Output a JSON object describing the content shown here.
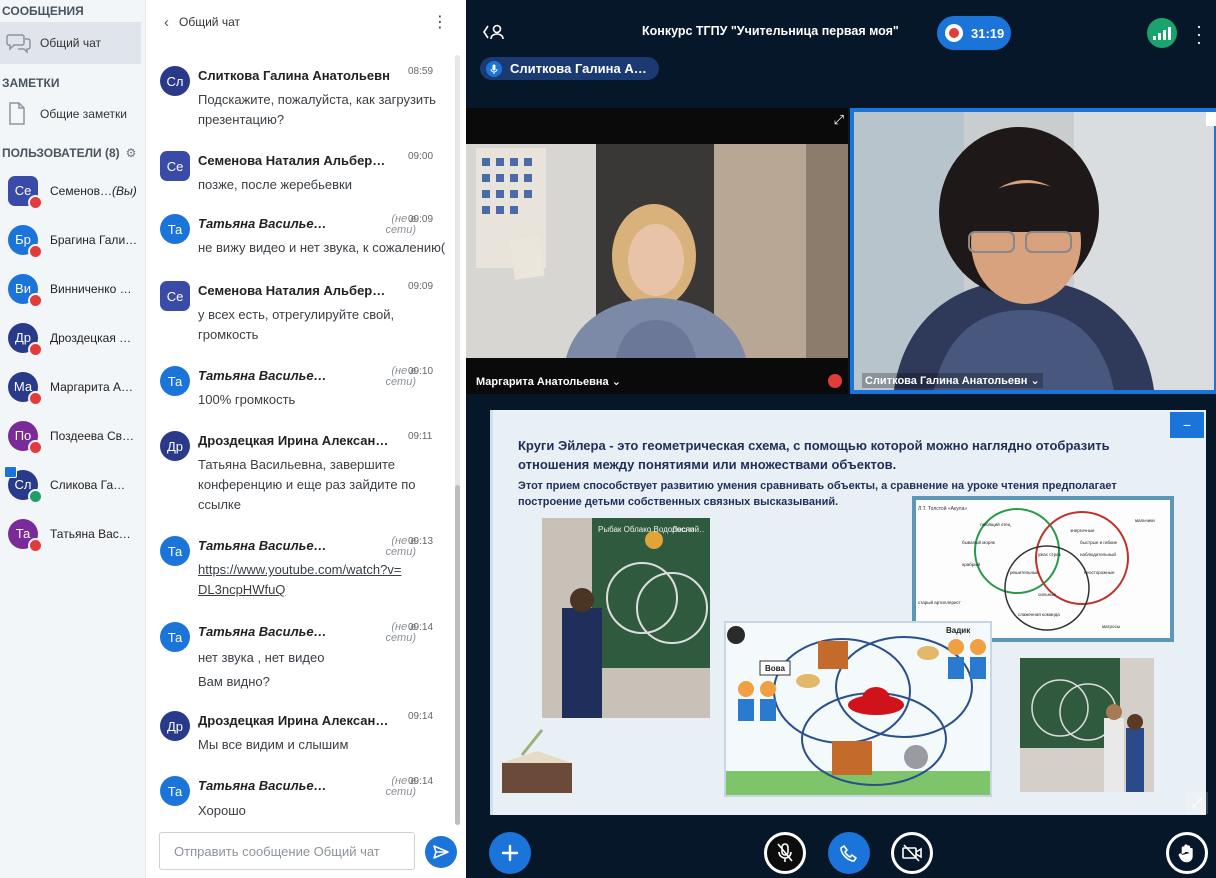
{
  "sidebar": {
    "messages_header": "СООБЩЕНИЯ",
    "public_chat": "Общий чат",
    "notes_header": "ЗАМЕТКИ",
    "shared_notes": "Общие заметки",
    "users_header": "ПОЛЬЗОВАТЕЛИ (8)",
    "users": [
      {
        "initials": "Се",
        "name": "Семенов…",
        "suffix": "(Вы)",
        "color": "#3a4aa8"
      },
      {
        "initials": "Бр",
        "name": "Брагина Гали…",
        "color": "#1b74d9"
      },
      {
        "initials": "Ви",
        "name": "Винниченко …",
        "color": "#1b74d9"
      },
      {
        "initials": "Др",
        "name": "Дроздецкая …",
        "color": "#2a3a8a"
      },
      {
        "initials": "Ма",
        "name": "Маргарита А…",
        "color": "#2a3a8a"
      },
      {
        "initials": "По",
        "name": "Поздеева Св…",
        "color": "#7b2a9a"
      },
      {
        "initials": "Сл",
        "name": "Сликова Га…",
        "color": "#2a3a8a"
      },
      {
        "initials": "Та",
        "name": "Татьяна Вас…",
        "color": "#7b2a9a"
      }
    ]
  },
  "chat": {
    "title": "Общий чат",
    "offline": "(не в сети)",
    "messages": [
      {
        "initials": "Сл",
        "name": "Слиткова Галина Анатольевн",
        "time": "08:59",
        "text": "Подскажите, пожалуйста, как загрузить презентацию?"
      },
      {
        "initials": "Се",
        "name": "Семенова Наталия Альбер…",
        "time": "09:00",
        "text": "позже, после жеребьевки"
      },
      {
        "initials": "Та",
        "name": "Татьяна Василье…",
        "time": "09:09",
        "text": "не вижу видео и нет звука, к сожалению("
      },
      {
        "initials": "Се",
        "name": "Семенова Наталия Альбер…",
        "time": "09:09",
        "text": "у всех есть, отрегулируйте свой, громкость"
      },
      {
        "initials": "Та",
        "name": "Татьяна Василье…",
        "time": "09:10",
        "text": "100% громкость"
      },
      {
        "initials": "Др",
        "name": "Дроздецкая Ирина Алексан…",
        "time": "09:11",
        "text": "Татьяна Васильевна, завершите конференцию и еще раз зайдите по ссылке"
      },
      {
        "initials": "Та",
        "name": "Татьяна Василье…",
        "time": "09:13",
        "text": "https://www.youtube.com/watch?v=DL3ncpHWfuQ"
      },
      {
        "initials": "Та",
        "name": "Татьяна Василье…",
        "time": "09:14",
        "text": "нет звука , нет видео",
        "text2": "Вам видно?"
      },
      {
        "initials": "Др",
        "name": "Дроздецкая Ирина Алексан…",
        "time": "09:14",
        "text": "Мы все видим и слышим"
      },
      {
        "initials": "Та",
        "name": "Татьяна Василье…",
        "time": "09:14",
        "text": "Хорошо"
      }
    ],
    "input_placeholder": "Отправить сообщение Общий чат"
  },
  "main": {
    "title": "Конкурс ТГПУ \"Учительница первая моя\"",
    "recording_time": "31:19",
    "talking": "Слиткова Галина А…",
    "video1_label": "Маргарита Анатольевна ⌄",
    "video2_label": "Слиткова Галина Анатольевн ⌄",
    "slide": {
      "title": "Круги Эйлера - это геометрическая схема, с помощью которой можно наглядно отобразить отношения между понятиями или множествами объектов.",
      "subtitle": "Этот прием способствует развитию умения сравнивать объекты, а сравнение на уроке чтения предполагает построение детьми собственных связных высказываний.",
      "diagram_title": "Л.Т. Толстой «Акула»",
      "labels": [
        "любящий отец",
        "энергичные",
        "мальчики",
        "бывалый моряк",
        "быстрые и гибкие",
        "ужас страх",
        "наблюдательный",
        "храбрый",
        "решительные",
        "неосторожные",
        "сильные",
        "старый артиллерист",
        "слаженная команда",
        "матросы"
      ],
      "vova": "Вова",
      "vadim": "Вадик",
      "board_left": "Рыбак Облако Водоросли …",
      "board_right": "Лесной"
    },
    "minimize": "−"
  }
}
